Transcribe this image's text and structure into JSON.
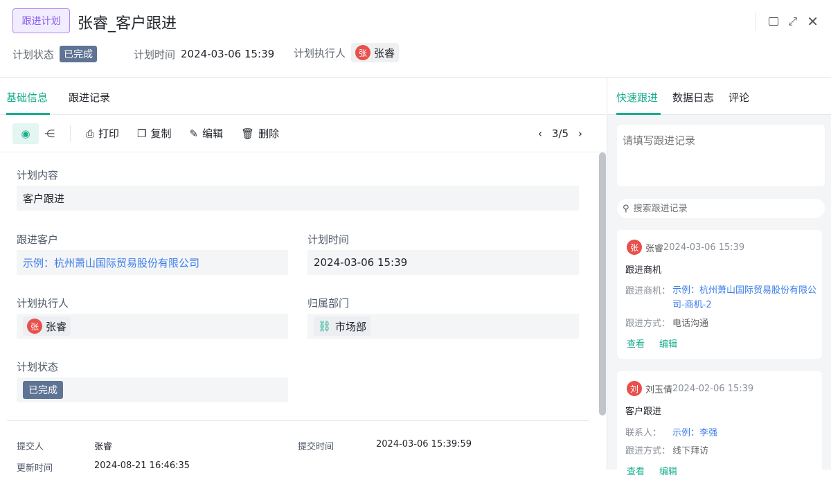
{
  "header": {
    "tag": "跟进计划",
    "title": "张睿_客户跟进",
    "status_label": "计划状态",
    "status": "已完成",
    "time_label": "计划时间",
    "time": "2024-03-06 15:39",
    "executor_label": "计划执行人",
    "executor_avatar": "张",
    "executor": "张睿"
  },
  "tabs": [
    {
      "label": "基础信息"
    },
    {
      "label": "跟进记录"
    }
  ],
  "toolbar": {
    "print": "打印",
    "copy": "复制",
    "edit": "编辑",
    "delete": "删除",
    "pager": "3/5"
  },
  "form": {
    "content_label": "计划内容",
    "content": "客户跟进",
    "customer_label": "跟进客户",
    "customer": "示例：杭州萧山国际贸易股份有限公司",
    "time_label": "计划时间",
    "time": "2024-03-06 15:39",
    "executor_label": "计划执行人",
    "executor_avatar": "张",
    "executor": "张睿",
    "dept_label": "归属部门",
    "dept": "市场部",
    "status_label": "计划状态",
    "status": "已完成"
  },
  "footer": {
    "submitter_label": "提交人",
    "submitter": "张睿",
    "submit_time_label": "提交时间",
    "submit_time": "2024-03-06 15:39:59",
    "update_label": "更新时间",
    "update_time": "2024-08-21 16:46:35"
  },
  "right": {
    "tabs": [
      {
        "label": "快速跟进"
      },
      {
        "label": "数据日志"
      },
      {
        "label": "评论"
      }
    ],
    "placeholder": "请填写跟进记录",
    "search_placeholder": "搜索跟进记录",
    "records": [
      {
        "avatar": "张",
        "name": "张睿",
        "time": "2024-03-06 15:39",
        "type": "跟进商机",
        "f1_label": "跟进商机：",
        "f1": "示例：杭州萧山国际贸易股份有限公司-商机-2",
        "f2_label": "跟进方式：",
        "f2": "电话沟通",
        "view": "查看",
        "edit": "编辑"
      },
      {
        "avatar": "刘",
        "name": "刘玉倩",
        "time": "2024-02-06 15:39",
        "type": "客户跟进",
        "f1_label": "联系人：",
        "f1": "示例：李强",
        "f2_label": "跟进方式：",
        "f2": "线下拜访",
        "view": "查看",
        "edit": "编辑"
      }
    ]
  }
}
